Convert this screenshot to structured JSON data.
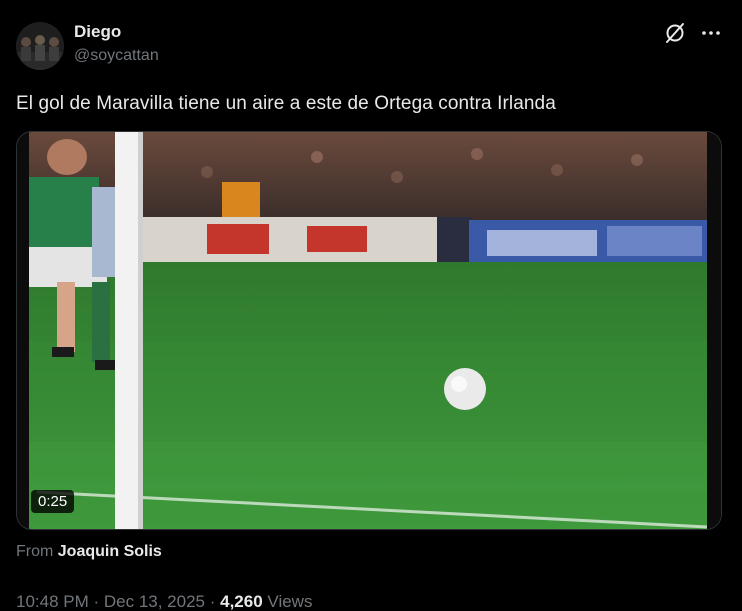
{
  "author": {
    "display_name": "Diego",
    "handle": "@soycattan"
  },
  "icons": {
    "avatar": "avatar-image",
    "grok": "grok-icon",
    "more": "more-icon"
  },
  "tweet": {
    "text": "El gol de Maravilla tiene un aire a este de Ortega contra Irlanda"
  },
  "media": {
    "type": "video",
    "duration": "0:25"
  },
  "attribution": {
    "prefix": "From",
    "name": "Joaquin Solis"
  },
  "meta": {
    "time": "10:48 PM",
    "separator": " · ",
    "date": "Dec 13, 2025",
    "views_count": "4,260",
    "views_label": "Views"
  },
  "colors": {
    "background": "#000000",
    "primary_text": "#e7e9ea",
    "secondary_text": "#71767b",
    "pitch_green": "#3d8a3a"
  }
}
